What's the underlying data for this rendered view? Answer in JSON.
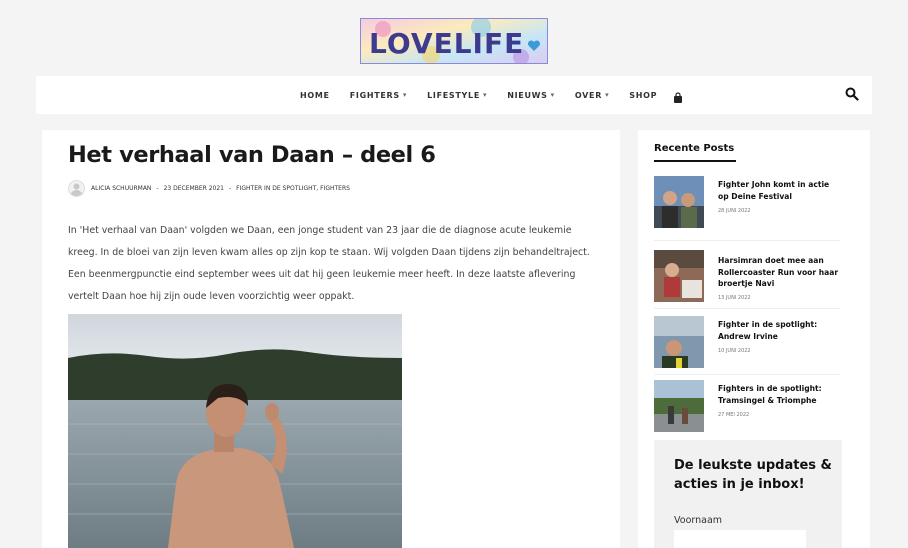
{
  "header": {
    "logo_text": "LOVELIFE",
    "logo_icon": "heart-icon"
  },
  "nav": {
    "items": [
      {
        "label": "HOME",
        "dropdown": false
      },
      {
        "label": "FIGHTERS",
        "dropdown": true
      },
      {
        "label": "LIFESTYLE",
        "dropdown": true
      },
      {
        "label": "NIEUWS",
        "dropdown": true
      },
      {
        "label": "OVER",
        "dropdown": true
      },
      {
        "label": "SHOP",
        "dropdown": false
      }
    ],
    "cart_icon": "shopping-bag-icon",
    "search_icon": "search-icon"
  },
  "article": {
    "title": "Het verhaal van Daan – deel 6",
    "author": "ALICIA SCHUURMAN",
    "date": "23 DECEMBER 2021",
    "categories": "FIGHTER IN DE SPOTLIGHT, FIGHTERS",
    "separator": "-",
    "body": "In 'Het verhaal van Daan' volgden we Daan, een jonge student van 23 jaar die de diagnose acute leukemie kreeg. In de bloei van zijn leven kwam alles op zijn kop te staan. Wij volgden Daan tijdens zijn behandeltraject. Een beenmergpunctie eind september wees uit dat hij geen leukemie meer heeft. In deze laatste aflevering vertelt Daan hoe hij zijn oude leven voorzichtig weer oppakt."
  },
  "sidebar": {
    "heading": "Recente Posts",
    "posts": [
      {
        "title": "Fighter John komt in actie op Deine Festival",
        "date": "28 JUNI 2022"
      },
      {
        "title": "Harsimran doet mee aan Rollercoaster Run voor haar broertje Navi",
        "date": "13 JUNI 2022"
      },
      {
        "title": "Fighter in de spotlight: Andrew Irvine",
        "date": "10 JUNI 2022"
      },
      {
        "title": "Fighters in de spotlight: Tramsingel & Triomphe",
        "date": "27 MEI 2022"
      }
    ],
    "newsletter": {
      "title": "De leukste updates & acties in je inbox!",
      "field_label": "Voornaam",
      "field_value": ""
    }
  },
  "colors": {
    "accent": "#3b82c4",
    "text": "#222222",
    "background": "#f4f4f4"
  }
}
